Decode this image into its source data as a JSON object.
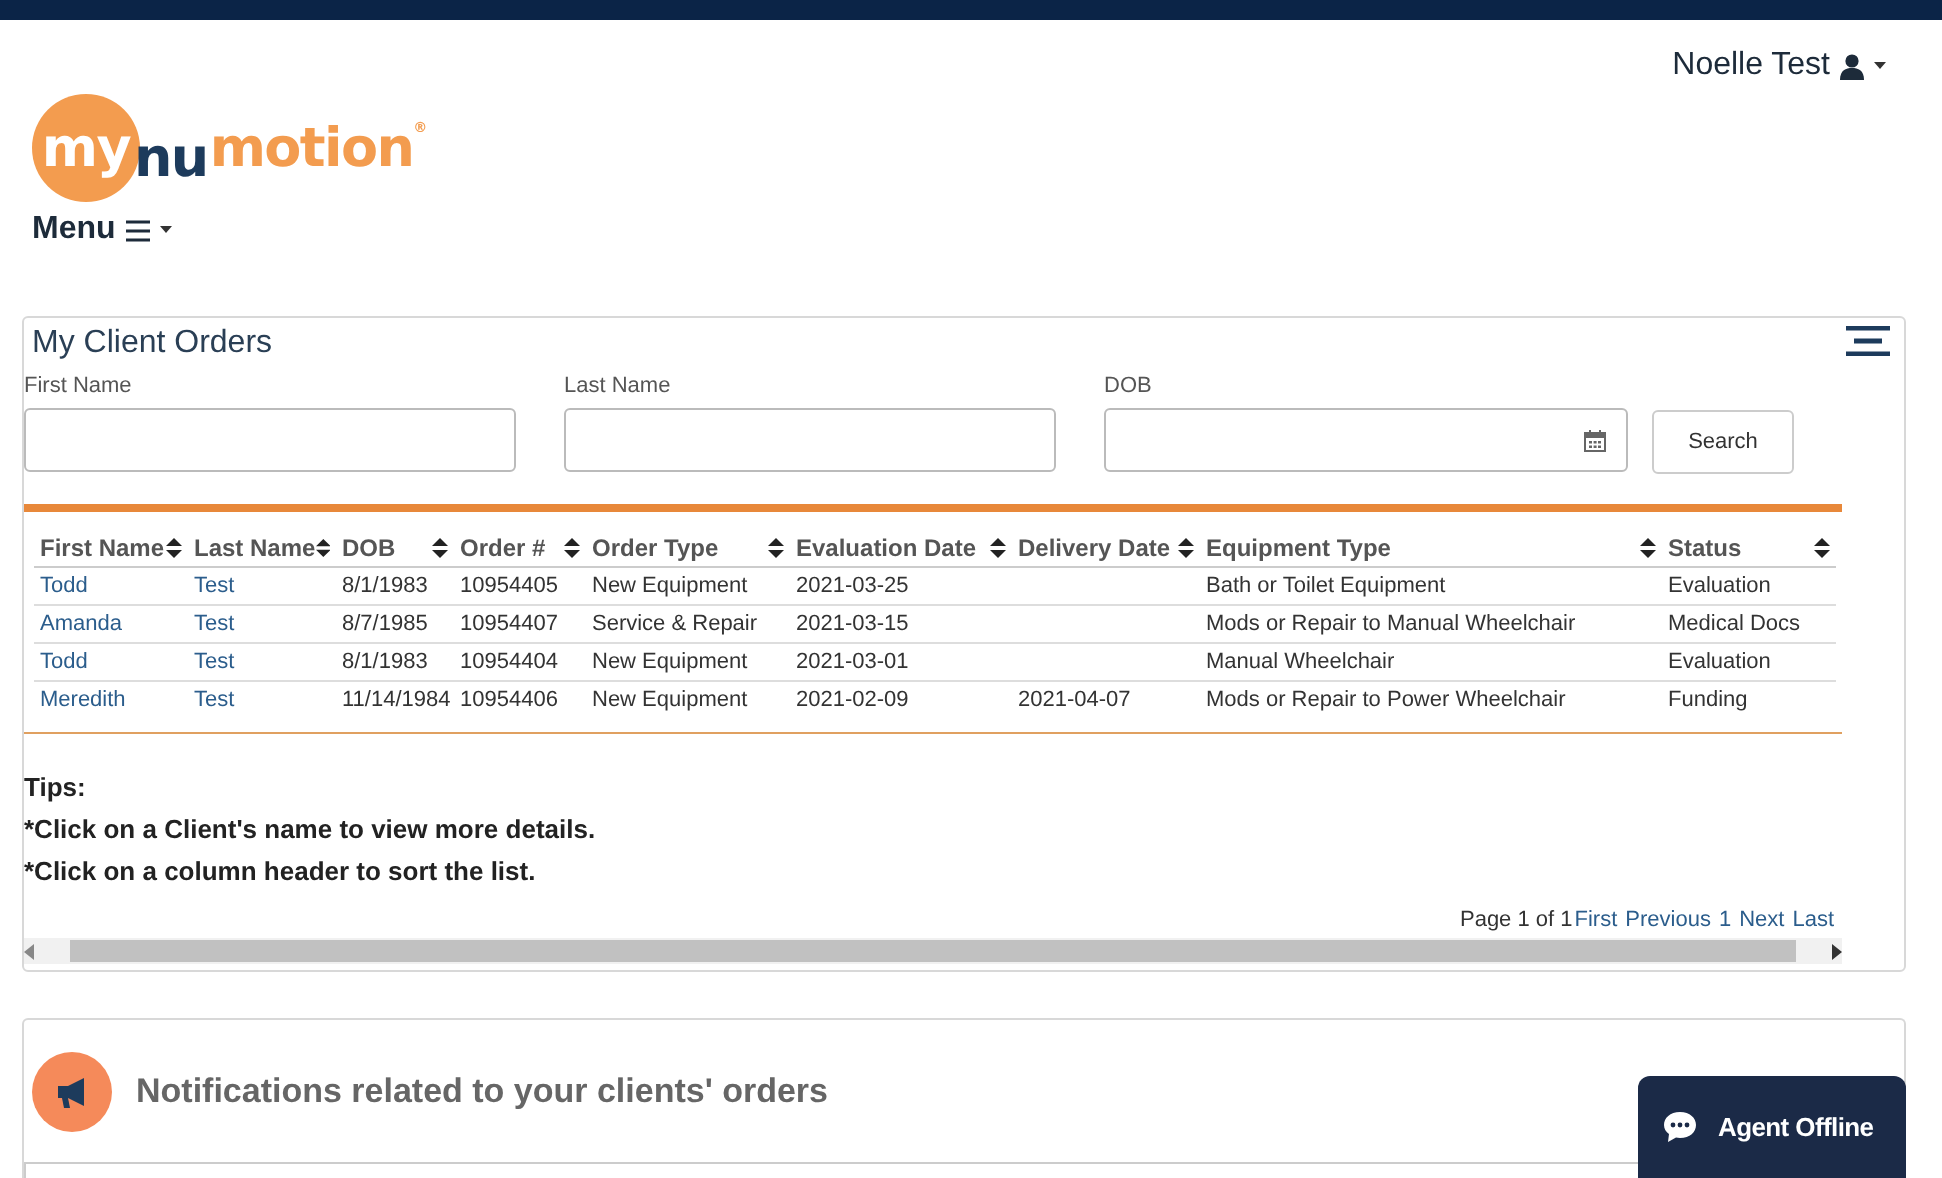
{
  "logo": {
    "part_1": "my",
    "part_2": "nu",
    "part_3": "motion",
    "mark": "®"
  },
  "menu": {
    "label": "Menu"
  },
  "user": {
    "name": "Noelle Test"
  },
  "orders_panel": {
    "title": "My Client Orders",
    "filters": [
      {
        "label": "First Name",
        "kind": "text"
      },
      {
        "label": "Last Name",
        "kind": "text"
      },
      {
        "label": "DOB",
        "kind": "date"
      }
    ],
    "search_button": "Search",
    "table": {
      "columns": [
        "First Name",
        "Last Name",
        "DOB",
        "Order #",
        "Order Type",
        "Evaluation Date",
        "Delivery Date",
        "Equipment Type",
        "Status"
      ],
      "rows": [
        [
          "Todd",
          "Test",
          "8/1/1983",
          "10954405",
          "New Equipment",
          "2021-03-25",
          "",
          "Bath or Toilet Equipment",
          "Evaluation"
        ],
        [
          "Amanda",
          "Test",
          "8/7/1985",
          "10954407",
          "Service & Repair",
          "2021-03-15",
          "",
          "Mods or Repair to Manual Wheelchair",
          "Medical Docs"
        ],
        [
          "Todd",
          "Test",
          "8/1/1983",
          "10954404",
          "New Equipment",
          "2021-03-01",
          "",
          "Manual Wheelchair",
          "Evaluation"
        ],
        [
          "Meredith",
          "Test",
          "11/14/1984",
          "10954406",
          "New Equipment",
          "2021-02-09",
          "2021-04-07",
          "Mods or Repair to Power Wheelchair",
          "Funding"
        ]
      ]
    },
    "tips": [
      "Tips:",
      "*Click on a Client's name to view more details.",
      "*Click on a column header to sort the list."
    ],
    "pagination": {
      "summary": "Page 1 of 1",
      "links": [
        "First",
        "Previous",
        "1",
        "Next",
        "Last"
      ]
    }
  },
  "notifications_panel": {
    "title": "Notifications related to your clients' orders"
  },
  "chat": {
    "label": "Agent Offline"
  }
}
